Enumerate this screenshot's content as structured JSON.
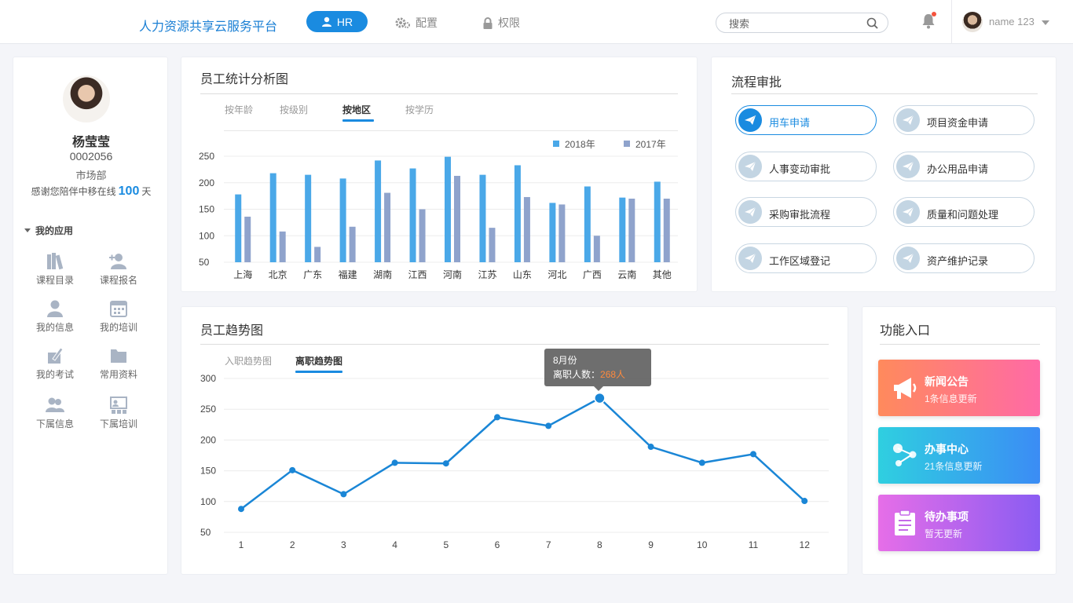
{
  "header": {
    "brand": "人力资源共享云服务平台",
    "nav": [
      {
        "label": "HR",
        "icon": "user-icon",
        "active": true
      },
      {
        "label": "配置",
        "icon": "gear-icon"
      },
      {
        "label": "权限",
        "icon": "lock-icon"
      }
    ],
    "search_placeholder": "搜索",
    "user_name": "name 123"
  },
  "profile": {
    "name": "杨莹莹",
    "id": "0002056",
    "department": "市场部",
    "days_prefix": "感谢您陪伴中移在线",
    "days": "100",
    "days_suffix": "天",
    "apps_title": "我的应用",
    "apps": [
      {
        "label": "课程目录",
        "icon": "books-icon"
      },
      {
        "label": "课程报名",
        "icon": "add-user-icon"
      },
      {
        "label": "我的信息",
        "icon": "person-icon"
      },
      {
        "label": "我的培训",
        "icon": "calendar-icon"
      },
      {
        "label": "我的考试",
        "icon": "exam-icon"
      },
      {
        "label": "常用资料",
        "icon": "folder-icon"
      },
      {
        "label": "下属信息",
        "icon": "group-icon"
      },
      {
        "label": "下属培训",
        "icon": "presentation-icon"
      }
    ]
  },
  "stats": {
    "title": "员工统计分析图",
    "tabs": [
      "按年龄",
      "按级别",
      "按地区",
      "按学历"
    ],
    "active_tab": 2
  },
  "flow": {
    "title": "流程审批",
    "items": [
      {
        "label": "用车申请",
        "active": true
      },
      {
        "label": "项目资金申请"
      },
      {
        "label": "人事变动审批"
      },
      {
        "label": "办公用品申请"
      },
      {
        "label": "采购审批流程"
      },
      {
        "label": "质量和问题处理"
      },
      {
        "label": "工作区域登记"
      },
      {
        "label": "资产维护记录"
      }
    ]
  },
  "trend": {
    "title": "员工趋势图",
    "tabs": [
      "入职趋势图",
      "离职趋势图"
    ],
    "active_tab": 1,
    "tooltip": {
      "title": "8月份",
      "label": "离职人数：",
      "value": "268人"
    }
  },
  "func": {
    "title": "功能入口",
    "cards": [
      {
        "title": "新闻公告",
        "sub": "1条信息更新",
        "icon": "megaphone-icon"
      },
      {
        "title": "办事中心",
        "sub": "21条信息更新",
        "icon": "molecule-icon"
      },
      {
        "title": "待办事项",
        "sub": "暂无更新",
        "icon": "clipboard-icon"
      }
    ]
  },
  "colors": {
    "accent": "#1a8be0",
    "bar2018": "#4aa8e8",
    "bar2017": "#8fa3cc",
    "line": "#1a86d6"
  },
  "chart_data": [
    {
      "type": "bar",
      "categories": [
        "上海",
        "北京",
        "广东",
        "福建",
        "湖南",
        "江西",
        "河南",
        "江苏",
        "山东",
        "河北",
        "广西",
        "云南",
        "其他"
      ],
      "series": [
        {
          "name": "2018年",
          "values": [
            178,
            218,
            215,
            208,
            242,
            227,
            249,
            215,
            233,
            162,
            193,
            172,
            202
          ]
        },
        {
          "name": "2017年",
          "values": [
            136,
            108,
            79,
            117,
            181,
            150,
            213,
            115,
            173,
            159,
            100,
            170,
            170
          ]
        }
      ],
      "yticks": [
        50,
        100,
        150,
        200,
        250
      ],
      "ylim": [
        50,
        250
      ],
      "legend": "top-right",
      "grid": true
    },
    {
      "type": "line",
      "x": [
        1,
        2,
        3,
        4,
        5,
        6,
        7,
        8,
        9,
        10,
        11,
        12
      ],
      "values": [
        88,
        151,
        112,
        163,
        162,
        237,
        223,
        268,
        189,
        163,
        177,
        101
      ],
      "yticks": [
        50,
        100,
        150,
        200,
        250,
        300
      ],
      "ylim": [
        50,
        300
      ],
      "highlight_index": 7,
      "grid": true
    }
  ]
}
